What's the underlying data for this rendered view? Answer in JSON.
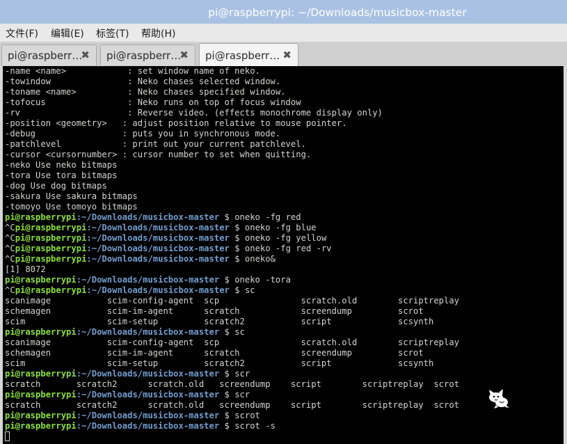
{
  "window": {
    "title": "pi@raspberrypi: ~/Downloads/musicbox-master"
  },
  "menu": [
    "文件(F)",
    "编辑(E)",
    "标签(T)",
    "帮助(H)"
  ],
  "tabs": [
    {
      "label": "pi@raspberr…",
      "close": "✖"
    },
    {
      "label": "pi@raspberr…",
      "close": "✖"
    },
    {
      "label": "pi@raspberr…",
      "close": "✖"
    }
  ],
  "prompt": {
    "user_host": "pi@raspberrypi",
    "path": ":~/Downloads/musicbox-master",
    "symbol": " $ "
  },
  "terminal_lines": [
    {
      "text": "-name <name>            : set window name of neko."
    },
    {
      "text": "-towindow               : Neko chases selected window."
    },
    {
      "text": "-toname <name>          : Neko chases specified window."
    },
    {
      "text": "-tofocus                : Neko runs on top of focus window"
    },
    {
      "text": "-rv                     : Reverse video. (effects monochrome display only)"
    },
    {
      "text": "-position <geometry>   : adjust position relative to mouse pointer."
    },
    {
      "text": "-debug                 : puts you in synchronous mode."
    },
    {
      "text": "-patchlevel            : print out your current patchlevel."
    },
    {
      "text": "-cursor <cursornumber> : cursor number to set when quitting."
    },
    {
      "text": "-neko Use neko bitmaps"
    },
    {
      "text": "-tora Use tora bitmaps"
    },
    {
      "text": "-dog Use dog bitmaps"
    },
    {
      "text": "-sakura Use sakura bitmaps"
    },
    {
      "text": "-tomoyo Use tomoyo bitmaps"
    },
    {
      "prompt": true,
      "prefix": "",
      "cmd": "oneko -fg red"
    },
    {
      "prompt": true,
      "prefix": "^C",
      "cmd": "oneko -fg blue"
    },
    {
      "prompt": true,
      "prefix": "^C",
      "cmd": "oneko -fg yellow"
    },
    {
      "prompt": true,
      "prefix": "^C",
      "cmd": "oneko -fg red -rv"
    },
    {
      "prompt": true,
      "prefix": "^C",
      "cmd": "oneko&"
    },
    {
      "text": "[1] 8072"
    },
    {
      "prompt": true,
      "prefix": "",
      "cmd": "oneko -tora"
    },
    {
      "prompt": true,
      "prefix": "^C",
      "cmd": "sc"
    },
    {
      "text": "scanimage           scim-config-agent  scp                scratch.old        scriptreplay"
    },
    {
      "text": "schemagen           scim-im-agent      scratch            screendump         scrot"
    },
    {
      "text": "scim                scim-setup         scratch2           script             scsynth"
    },
    {
      "prompt": true,
      "prefix": "",
      "cmd": "sc"
    },
    {
      "text": "scanimage           scim-config-agent  scp                scratch.old        scriptreplay"
    },
    {
      "text": "schemagen           scim-im-agent      scratch            screendump         scrot"
    },
    {
      "text": "scim                scim-setup         scratch2           script             scsynth"
    },
    {
      "prompt": true,
      "prefix": "",
      "cmd": "scr"
    },
    {
      "text": "scratch       scratch2      scratch.old   screendump    script        scriptreplay  scrot"
    },
    {
      "prompt": true,
      "prefix": "",
      "cmd": "scr"
    },
    {
      "text": "scratch       scratch2      scratch.old   screendump    script        scriptreplay  scrot"
    },
    {
      "prompt": true,
      "prefix": "",
      "cmd": "scrot"
    },
    {
      "prompt": true,
      "prefix": "",
      "cmd": "scrot -s"
    },
    {
      "cursor": true
    }
  ],
  "colors": {
    "terminal_bg": "#000000",
    "terminal_fg": "#d3d7cf",
    "user_host": "#8ae234",
    "path": "#729fcf",
    "titlebar": "#a9c1e3"
  },
  "icons": {
    "close": "close-icon",
    "sprite": "neko-cat-icon"
  }
}
